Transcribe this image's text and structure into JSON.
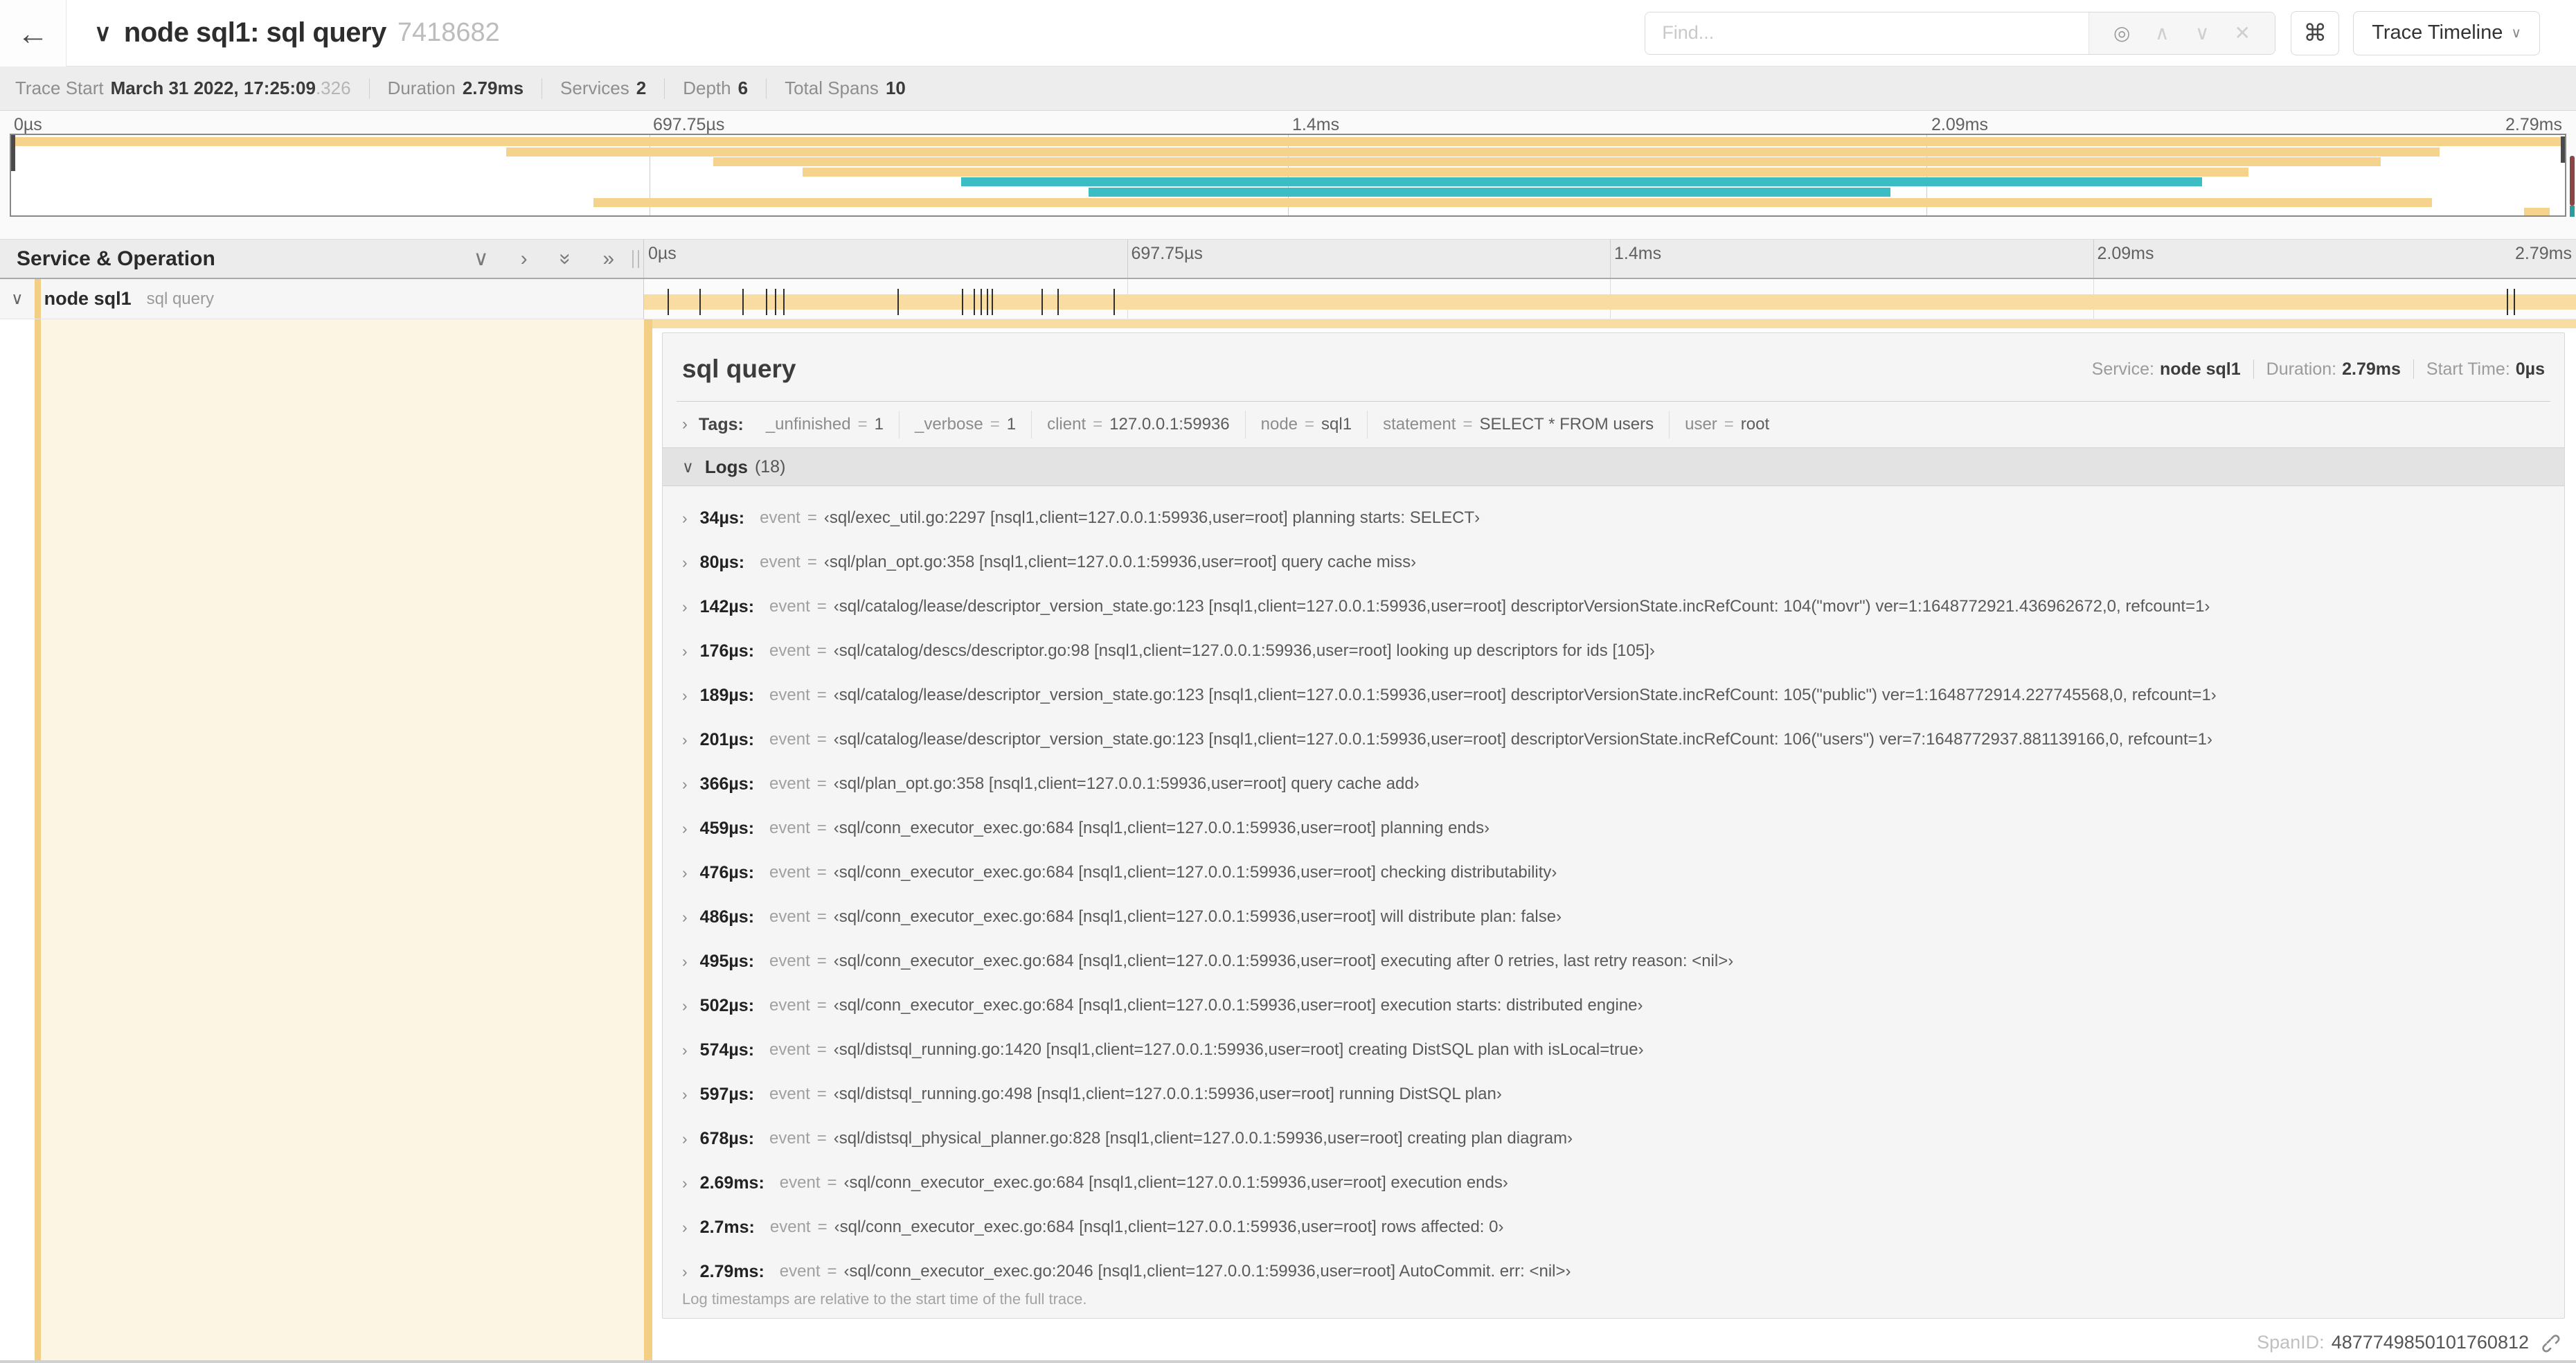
{
  "glyphs": {
    "back": "←",
    "collapse": "∨",
    "chevron_down": "∨",
    "chevron_right": "›",
    "double_chevron": "»",
    "target": "◎",
    "up": "∧",
    "down": "∨",
    "close": "✕",
    "cmd": "⌘"
  },
  "colors": {
    "tan_bar": "#f8dca2",
    "tan_minimap": "#f5d38c",
    "tan_stripe": "#f3ce85",
    "teal": "#3cbdc3",
    "cream": "#fcf5e4"
  },
  "header": {
    "title": "node sql1: sql query",
    "trace_id": "7418682",
    "find_placeholder": "Find...",
    "view_button_label": "Trace Timeline"
  },
  "trace_meta": {
    "items": [
      {
        "label": "Trace Start",
        "value": "March 31 2022, 17:25:09",
        "suffix": ".326"
      },
      {
        "label": "Duration",
        "value": "2.79ms",
        "suffix": ""
      },
      {
        "label": "Services",
        "value": "2",
        "suffix": ""
      },
      {
        "label": "Depth",
        "value": "6",
        "suffix": ""
      },
      {
        "label": "Total Spans",
        "value": "10",
        "suffix": ""
      }
    ]
  },
  "minimap": {
    "bars": [
      {
        "row": 0,
        "left": 0,
        "width": 100,
        "color": "tan_minimap"
      },
      {
        "row": 1,
        "left": 19.4,
        "width": 75.7,
        "color": "tan_minimap"
      },
      {
        "row": 2,
        "left": 27.5,
        "width": 65.3,
        "color": "tan_minimap"
      },
      {
        "row": 3,
        "left": 31.0,
        "width": 56.6,
        "color": "tan_minimap"
      },
      {
        "row": 4,
        "left": 37.2,
        "width": 48.6,
        "color": "teal"
      },
      {
        "row": 5,
        "left": 42.2,
        "width": 31.4,
        "color": "teal"
      },
      {
        "row": 6,
        "left": 22.8,
        "width": 72.0,
        "color": "tan_minimap"
      },
      {
        "row": 7,
        "left": 98.4,
        "width": 1.0,
        "color": "tan_minimap"
      }
    ]
  },
  "timeline": {
    "ruler_labels": [
      {
        "text": "0µs",
        "pos": 0,
        "align": "left"
      },
      {
        "text": "697.75µs",
        "pos": 25,
        "align": "left"
      },
      {
        "text": "1.4ms",
        "pos": 50,
        "align": "left"
      },
      {
        "text": "2.09ms",
        "pos": 75,
        "align": "left"
      },
      {
        "text": "2.79ms",
        "pos": 100,
        "align": "right"
      }
    ],
    "section_title": "Service & Operation",
    "row": {
      "service": "node sql1",
      "operation": "sql query"
    },
    "tick_percents": [
      1.22,
      2.87,
      5.09,
      6.31,
      6.77,
      7.2,
      13.12,
      16.45,
      17.06,
      17.42,
      17.74,
      17.99,
      20.57,
      21.4,
      24.3,
      96.42,
      96.77
    ]
  },
  "detail": {
    "title": "sql query",
    "service_label": "Service:",
    "service_value": "node sql1",
    "duration_label": "Duration:",
    "duration_value": "2.79ms",
    "start_label": "Start Time:",
    "start_value": "0µs",
    "tags_label": "Tags:",
    "tags": [
      {
        "key": "_unfinished",
        "value": "1"
      },
      {
        "key": "_verbose",
        "value": "1"
      },
      {
        "key": "client",
        "value": "127.0.0.1:59936"
      },
      {
        "key": "node",
        "value": "sql1"
      },
      {
        "key": "statement",
        "value": "SELECT * FROM users"
      },
      {
        "key": "user",
        "value": "root"
      }
    ],
    "logs_title": "Logs",
    "logs_count": "(18)",
    "logs": [
      {
        "time": "34µs:",
        "key": "event",
        "value": "‹sql/exec_util.go:2297 [nsql1,client=127.0.0.1:59936,user=root] planning starts: SELECT›"
      },
      {
        "time": "80µs:",
        "key": "event",
        "value": "‹sql/plan_opt.go:358 [nsql1,client=127.0.0.1:59936,user=root] query cache miss›"
      },
      {
        "time": "142µs:",
        "key": "event",
        "value": "‹sql/catalog/lease/descriptor_version_state.go:123 [nsql1,client=127.0.0.1:59936,user=root] descriptorVersionState.incRefCount: 104(\"movr\") ver=1:1648772921.436962672,0, refcount=1›"
      },
      {
        "time": "176µs:",
        "key": "event",
        "value": "‹sql/catalog/descs/descriptor.go:98 [nsql1,client=127.0.0.1:59936,user=root] looking up descriptors for ids [105]›"
      },
      {
        "time": "189µs:",
        "key": "event",
        "value": "‹sql/catalog/lease/descriptor_version_state.go:123 [nsql1,client=127.0.0.1:59936,user=root] descriptorVersionState.incRefCount: 105(\"public\") ver=1:1648772914.227745568,0, refcount=1›"
      },
      {
        "time": "201µs:",
        "key": "event",
        "value": "‹sql/catalog/lease/descriptor_version_state.go:123 [nsql1,client=127.0.0.1:59936,user=root] descriptorVersionState.incRefCount: 106(\"users\") ver=7:1648772937.881139166,0, refcount=1›"
      },
      {
        "time": "366µs:",
        "key": "event",
        "value": "‹sql/plan_opt.go:358 [nsql1,client=127.0.0.1:59936,user=root] query cache add›"
      },
      {
        "time": "459µs:",
        "key": "event",
        "value": "‹sql/conn_executor_exec.go:684 [nsql1,client=127.0.0.1:59936,user=root] planning ends›"
      },
      {
        "time": "476µs:",
        "key": "event",
        "value": "‹sql/conn_executor_exec.go:684 [nsql1,client=127.0.0.1:59936,user=root] checking distributability›"
      },
      {
        "time": "486µs:",
        "key": "event",
        "value": "‹sql/conn_executor_exec.go:684 [nsql1,client=127.0.0.1:59936,user=root] will distribute plan: false›"
      },
      {
        "time": "495µs:",
        "key": "event",
        "value": "‹sql/conn_executor_exec.go:684 [nsql1,client=127.0.0.1:59936,user=root] executing after 0 retries, last retry reason: <nil>›"
      },
      {
        "time": "502µs:",
        "key": "event",
        "value": "‹sql/conn_executor_exec.go:684 [nsql1,client=127.0.0.1:59936,user=root] execution starts: distributed engine›"
      },
      {
        "time": "574µs:",
        "key": "event",
        "value": "‹sql/distsql_running.go:1420 [nsql1,client=127.0.0.1:59936,user=root] creating DistSQL plan with isLocal=true›"
      },
      {
        "time": "597µs:",
        "key": "event",
        "value": "‹sql/distsql_running.go:498 [nsql1,client=127.0.0.1:59936,user=root] running DistSQL plan›"
      },
      {
        "time": "678µs:",
        "key": "event",
        "value": "‹sql/distsql_physical_planner.go:828 [nsql1,client=127.0.0.1:59936,user=root] creating plan diagram›"
      },
      {
        "time": "2.69ms:",
        "key": "event",
        "value": "‹sql/conn_executor_exec.go:684 [nsql1,client=127.0.0.1:59936,user=root] execution ends›"
      },
      {
        "time": "2.7ms:",
        "key": "event",
        "value": "‹sql/conn_executor_exec.go:684 [nsql1,client=127.0.0.1:59936,user=root] rows affected: 0›"
      },
      {
        "time": "2.79ms:",
        "key": "event",
        "value": "‹sql/conn_executor_exec.go:2046 [nsql1,client=127.0.0.1:59936,user=root] AutoCommit. err: <nil>›"
      }
    ],
    "footer_note": "Log timestamps are relative to the start time of the full trace.",
    "span_id_label": "SpanID:",
    "span_id": "4877749850101760812"
  }
}
